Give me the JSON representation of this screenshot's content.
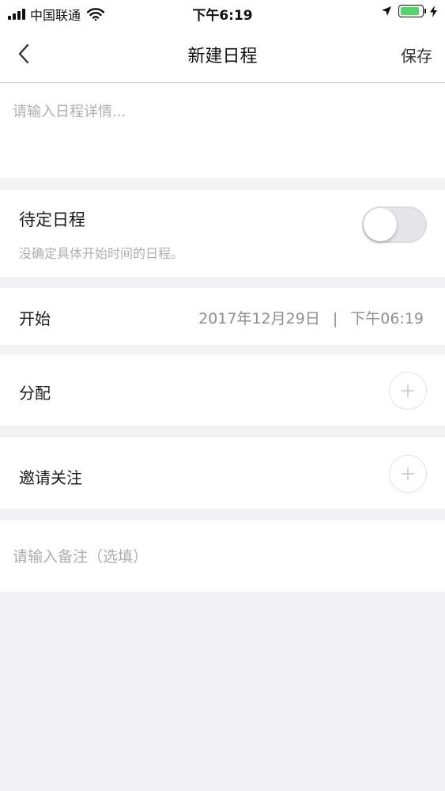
{
  "status_bar": {
    "carrier": "中国联通",
    "time": "下午6:19",
    "battery_level": 0.9,
    "battery_color": "#4cd964"
  },
  "nav": {
    "title": "新建日程",
    "save_label": "保存",
    "back_icon": "chevron-left-icon"
  },
  "detail": {
    "placeholder": "请输入日程详情..."
  },
  "pending": {
    "title": "待定日程",
    "subtitle": "没确定具体开始时间的日程。",
    "toggle_on": false
  },
  "start": {
    "label": "开始",
    "date": "2017年12月29日",
    "separator": "|",
    "time": "下午06:19"
  },
  "assign": {
    "label": "分配",
    "add_icon": "plus-icon"
  },
  "invite": {
    "label": "邀请关注",
    "add_icon": "plus-icon"
  },
  "note": {
    "placeholder": "请输入备注（选填）"
  }
}
